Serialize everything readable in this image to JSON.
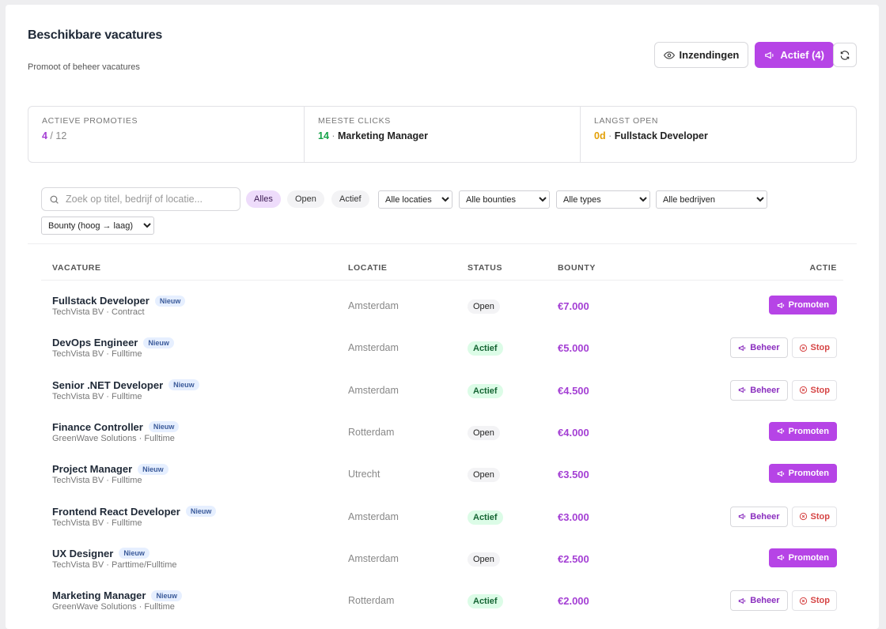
{
  "header": {
    "title": "Beschikbare vacatures",
    "subtitle": "Promoot of beheer vacatures",
    "submissions_label": "Inzendingen",
    "active_label": "Actief (4)",
    "refresh_icon": "refresh-icon"
  },
  "stats": {
    "active_promotions": {
      "label": "ACTIEVE PROMOTIES",
      "value": "4",
      "sep": " / ",
      "total": "12"
    },
    "most_clicks": {
      "label": "MEESTE CLICKS",
      "value": "14",
      "sep": " · ",
      "name": "Marketing Manager"
    },
    "longest_open": {
      "label": "LANGST OPEN",
      "value": "0d",
      "sep": " · ",
      "name": "Fullstack Developer"
    }
  },
  "filters": {
    "search_placeholder": "Zoek op titel, bedrijf of locatie...",
    "chips": [
      "Alles",
      "Open",
      "Actief"
    ],
    "location": "Alle locaties",
    "bounties": "Alle bounties",
    "types": "Alle types",
    "companies": "Alle bedrijven",
    "sort": "Bounty (hoog → laag)"
  },
  "table": {
    "headers": {
      "job": "VACATURE",
      "location": "LOCATIE",
      "status": "STATUS",
      "bounty": "BOUNTY",
      "action": "ACTIE"
    },
    "new_badge": "Nieuw",
    "promote_label": "Promoten",
    "manage_label": "Beheer",
    "stop_label": "Stop",
    "rows": [
      {
        "title": "Fullstack Developer",
        "sub": "TechVista BV · Contract",
        "location": "Amsterdam",
        "status": "Open",
        "bounty": "€7.000"
      },
      {
        "title": "DevOps Engineer",
        "sub": "TechVista BV · Fulltime",
        "location": "Amsterdam",
        "status": "Actief",
        "bounty": "€5.000"
      },
      {
        "title": "Senior .NET Developer",
        "sub": "TechVista BV · Fulltime",
        "location": "Amsterdam",
        "status": "Actief",
        "bounty": "€4.500"
      },
      {
        "title": "Finance Controller",
        "sub": "GreenWave Solutions · Fulltime",
        "location": "Rotterdam",
        "status": "Open",
        "bounty": "€4.000"
      },
      {
        "title": "Project Manager",
        "sub": "TechVista BV · Fulltime",
        "location": "Utrecht",
        "status": "Open",
        "bounty": "€3.500"
      },
      {
        "title": "Frontend React Developer",
        "sub": "TechVista BV · Fulltime",
        "location": "Amsterdam",
        "status": "Actief",
        "bounty": "€3.000"
      },
      {
        "title": "UX Designer",
        "sub": "TechVista BV · Parttime/Fulltime",
        "location": "Amsterdam",
        "status": "Open",
        "bounty": "€2.500"
      },
      {
        "title": "Marketing Manager",
        "sub": "GreenWave Solutions · Fulltime",
        "location": "Rotterdam",
        "status": "Actief",
        "bounty": "€2.000"
      }
    ]
  },
  "colors": {
    "accent": "#b644e6",
    "bounty": "#a43fd4",
    "active_bg": "#dcfce7",
    "stop": "#d64545"
  }
}
